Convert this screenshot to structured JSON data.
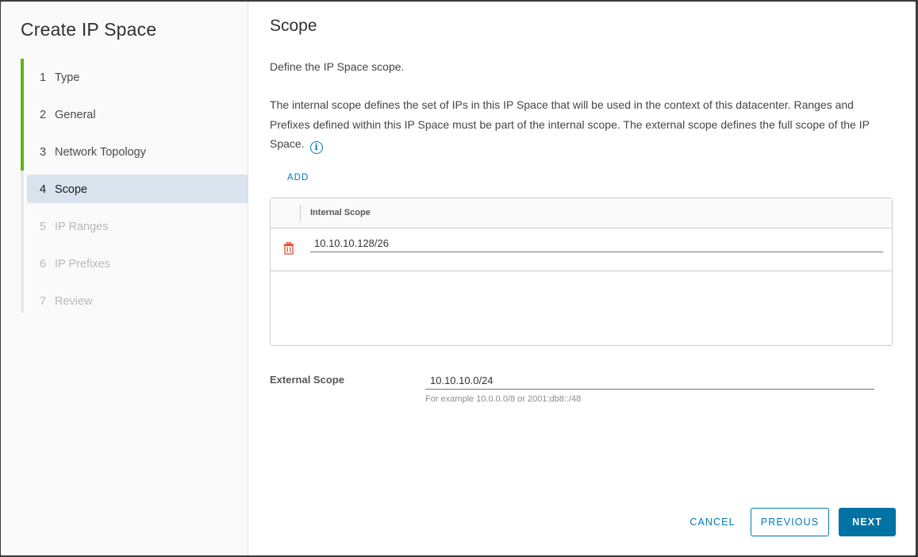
{
  "wizard": {
    "title": "Create IP Space",
    "steps": [
      {
        "num": "1",
        "label": "Type",
        "state": "done"
      },
      {
        "num": "2",
        "label": "General",
        "state": "done"
      },
      {
        "num": "3",
        "label": "Network Topology",
        "state": "done"
      },
      {
        "num": "4",
        "label": "Scope",
        "state": "active"
      },
      {
        "num": "5",
        "label": "IP Ranges",
        "state": "disabled"
      },
      {
        "num": "6",
        "label": "IP Prefixes",
        "state": "disabled"
      },
      {
        "num": "7",
        "label": "Review",
        "state": "disabled"
      }
    ]
  },
  "page": {
    "title": "Scope",
    "subtitle": "Define the IP Space scope.",
    "description": "The internal scope defines the set of IPs in this IP Space that will be used in the context of this datacenter. Ranges and Prefixes defined within this IP Space must be part of the internal scope. The external scope defines the full scope of the IP Space.",
    "info_icon": "info-circle-icon",
    "add_label": "ADD"
  },
  "internal_scope": {
    "column_header": "Internal Scope",
    "rows": [
      {
        "value": "10.10.10.128/26",
        "action_icon": "trash-icon"
      }
    ]
  },
  "external_scope": {
    "label": "External Scope",
    "value": "10.10.10.0/24",
    "helper": "For example 10.0.0.0/8 or 2001:db8::/48"
  },
  "footer": {
    "cancel_label": "CANCEL",
    "previous_label": "PREVIOUS",
    "next_label": "NEXT"
  },
  "colors": {
    "accent": "#0079b8",
    "primary_button": "#0072a3",
    "step_done": "#5eb715",
    "step_active_bg": "#d8e3ed",
    "delete_icon": "#e04f2a"
  }
}
